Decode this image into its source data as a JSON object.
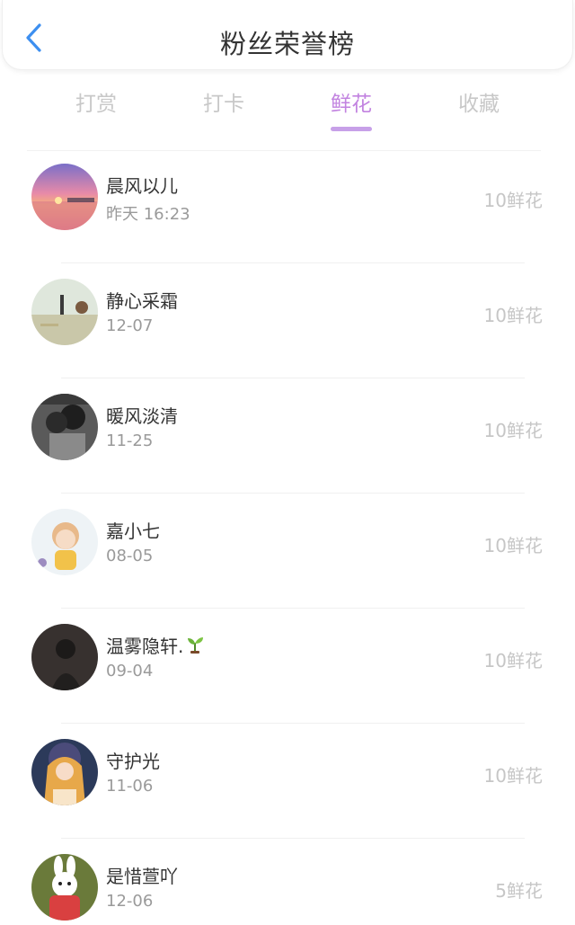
{
  "header": {
    "title": "粉丝荣誉榜",
    "back_icon": "chevron-left-icon",
    "accent": "#3d8ff0"
  },
  "tabs": [
    {
      "label": "打赏",
      "active": false
    },
    {
      "label": "打卡",
      "active": false
    },
    {
      "label": "鲜花",
      "active": true
    },
    {
      "label": "收藏",
      "active": false
    }
  ],
  "colors": {
    "active_tab": "#c283e0",
    "inactive_tab": "#c8c8c8",
    "amount": "#c6c6c6"
  },
  "list": [
    {
      "name": "晨风以儿",
      "time": "昨天 16:23",
      "amount": "10鲜花"
    },
    {
      "name": "静心采霜",
      "time": "12-07",
      "amount": "10鲜花"
    },
    {
      "name": "暖风淡清",
      "time": "11-25",
      "amount": "10鲜花"
    },
    {
      "name": "嘉小七",
      "time": "08-05",
      "amount": "10鲜花"
    },
    {
      "name": "温雾隐轩.",
      "time": "09-04",
      "amount": "10鲜花",
      "emoji_icon": "seedling-icon"
    },
    {
      "name": "守护光",
      "time": "11-06",
      "amount": "10鲜花"
    },
    {
      "name": "是惜萱吖",
      "time": "12-06",
      "amount": "5鲜花"
    }
  ]
}
